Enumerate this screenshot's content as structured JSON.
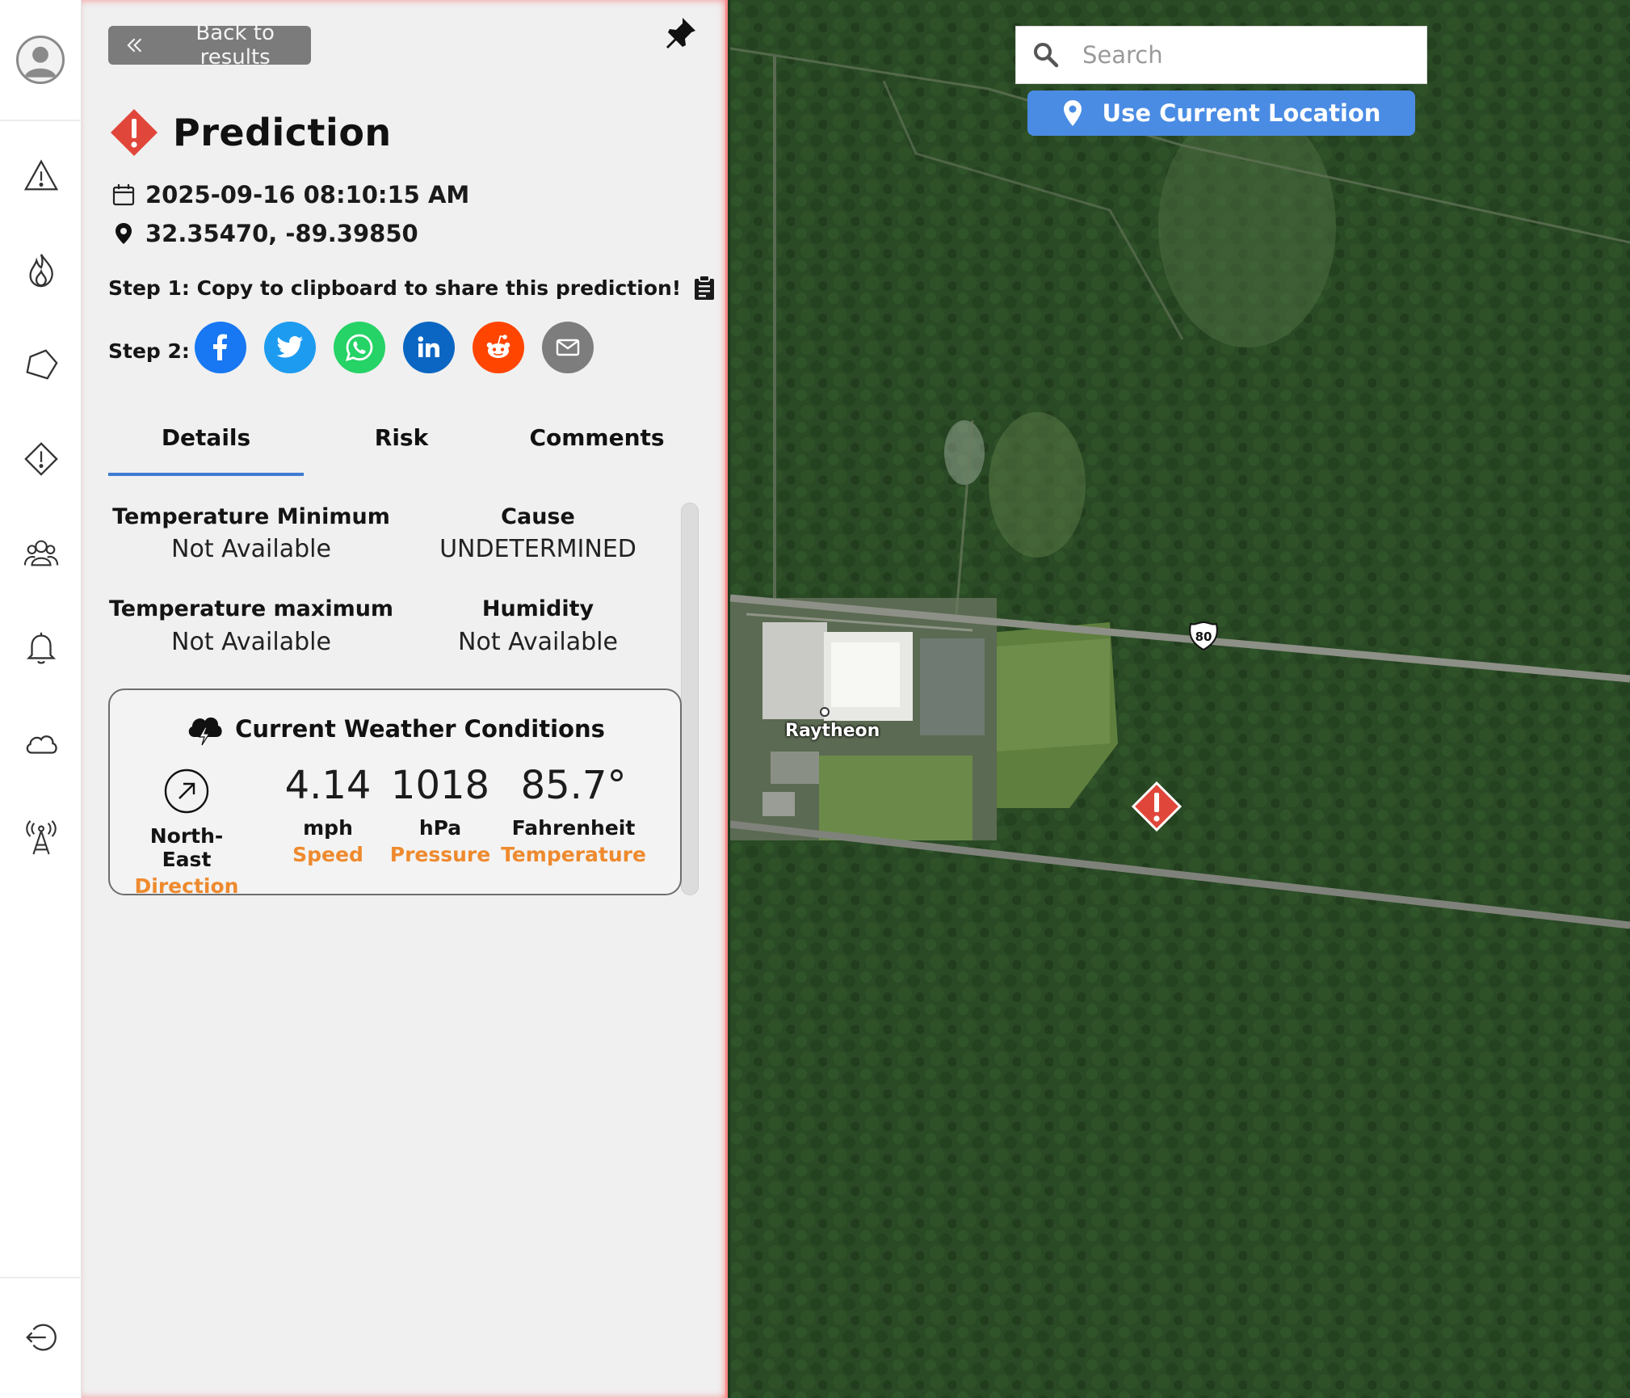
{
  "panel": {
    "back_label": "Back to results",
    "title": "Prediction",
    "datetime": "2025-09-16 08:10:15 AM",
    "coordinates": "32.35470, -89.39850",
    "step1": "Step 1: Copy to clipboard to share this prediction!",
    "step2": "Step 2:",
    "share_buttons": [
      {
        "icon": "facebook-icon",
        "color": "#1877f2"
      },
      {
        "icon": "twitter-icon",
        "color": "#1d9bf0"
      },
      {
        "icon": "whatsapp-icon",
        "color": "#25d366"
      },
      {
        "icon": "linkedin-icon",
        "color": "#0a66c2"
      },
      {
        "icon": "reddit-icon",
        "color": "#ff4500"
      },
      {
        "icon": "email-icon",
        "color": "#7d7d7d"
      }
    ],
    "tabs": [
      {
        "label": "Details",
        "active": true
      },
      {
        "label": "Risk",
        "active": false
      },
      {
        "label": "Comments",
        "active": false
      }
    ],
    "details": [
      {
        "label": "Temperature Minimum",
        "value": "Not Available"
      },
      {
        "label": "Cause",
        "value": "UNDETERMINED"
      },
      {
        "label": "Temperature maximum",
        "value": "Not Available"
      },
      {
        "label": "Humidity",
        "value": "Not Available"
      }
    ],
    "weather": {
      "title": "Current Weather Conditions",
      "direction": {
        "value": "North-East",
        "caption": "Direction"
      },
      "speed": {
        "value": "4.14",
        "unit": "mph",
        "caption": "Speed"
      },
      "pressure": {
        "value": "1018",
        "unit": "hPa",
        "caption": "Pressure"
      },
      "temperature": {
        "value": "85.7°",
        "unit": "Fahrenheit",
        "caption": "Temperature"
      }
    }
  },
  "rail": {
    "icons": [
      "user-avatar-icon",
      "alert-triangle-icon",
      "fire-icon",
      "polygon-icon",
      "warning-diamond-icon",
      "community-icon",
      "bell-icon",
      "cloud-icon",
      "antenna-icon",
      "logout-icon"
    ]
  },
  "map": {
    "search_placeholder": "Search",
    "location_button": "Use Current Location",
    "poi_label": "Raytheon",
    "highway_shield": "80"
  },
  "colors": {
    "accent_blue": "#4a8ce4",
    "alert_red": "#e0473a",
    "caption_orange": "#ee8a2e",
    "panel_border": "#ff8a8a"
  }
}
